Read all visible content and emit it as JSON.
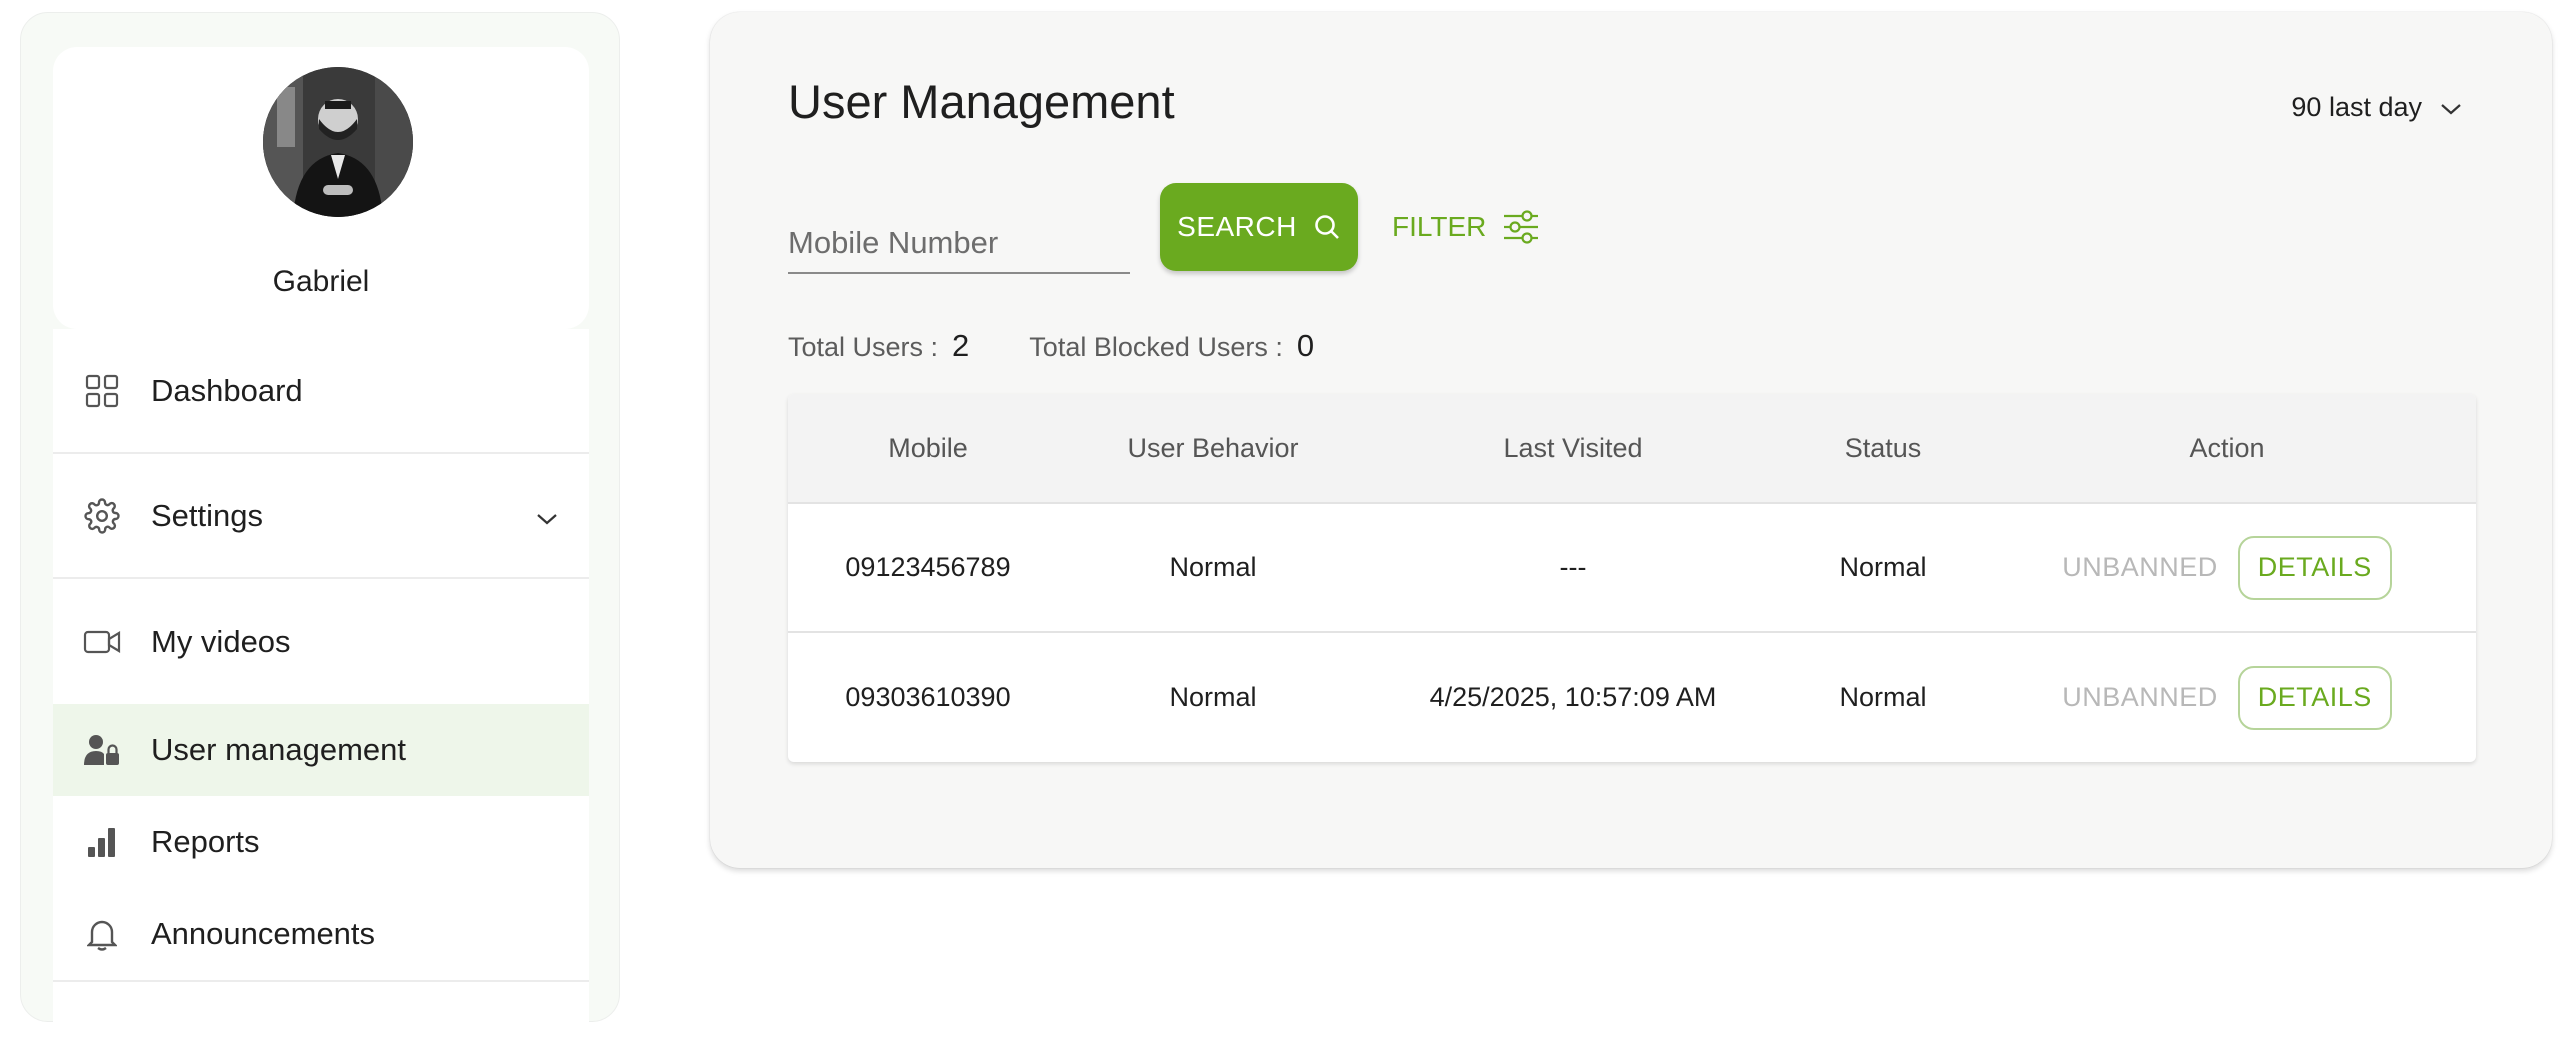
{
  "profile": {
    "name": "Gabriel"
  },
  "sidebar": {
    "items": [
      {
        "label": "Dashboard",
        "icon": "grid-icon"
      },
      {
        "label": "Settings",
        "icon": "gear-icon"
      },
      {
        "label": "My videos",
        "icon": "video-camera-icon"
      },
      {
        "label": "User management",
        "icon": "user-lock-icon",
        "active": true
      },
      {
        "label": "Reports",
        "icon": "bar-chart-icon"
      },
      {
        "label": "Announcements",
        "icon": "bell-icon"
      }
    ]
  },
  "main": {
    "title": "User Management",
    "range": "90 last day",
    "search": {
      "placeholder": "Mobile Number",
      "button_label": "SEARCH"
    },
    "filter_label": "FILTER",
    "stats": {
      "total_users_label": "Total Users :",
      "total_users": "2",
      "blocked_label": "Total Blocked Users :",
      "blocked": "0"
    },
    "table": {
      "headers": [
        "Mobile",
        "User Behavior",
        "Last Visited",
        "Status",
        "Action"
      ],
      "rows": [
        {
          "mobile": "09123456789",
          "behavior": "Normal",
          "last_visited": "---",
          "status": "Normal",
          "ban_label": "UNBANNED",
          "details_label": "DETAILS"
        },
        {
          "mobile": "09303610390",
          "behavior": "Normal",
          "last_visited": "4/25/2025, 10:57:09 AM",
          "status": "Normal",
          "ban_label": "UNBANNED",
          "details_label": "DETAILS"
        }
      ]
    }
  },
  "colors": {
    "accent": "#6aaa1f",
    "active_bg": "#eef6ea"
  }
}
